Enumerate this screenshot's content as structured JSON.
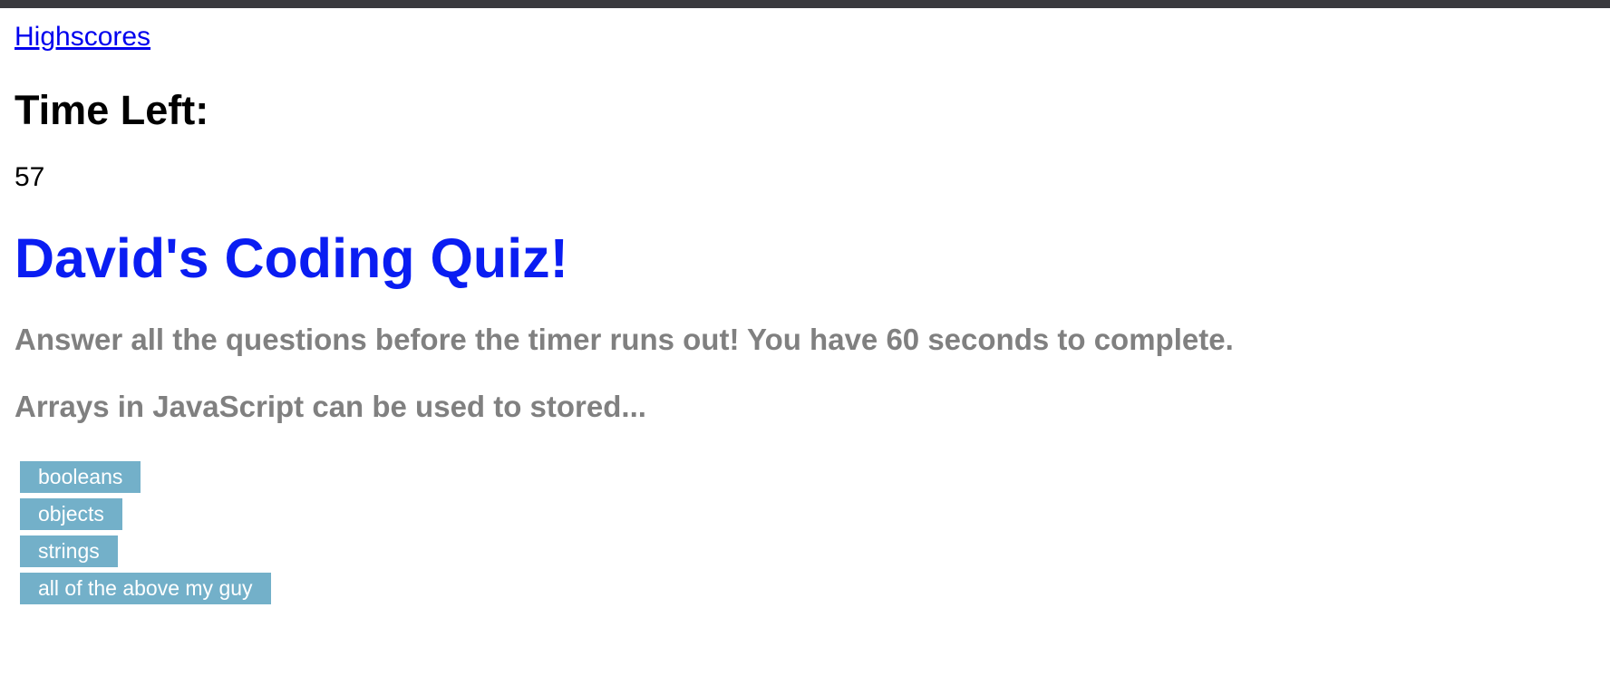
{
  "nav": {
    "highscores_label": "Highscores"
  },
  "timer": {
    "label": "Time Left:",
    "value": "57"
  },
  "quiz": {
    "title": "David's Coding Quiz!",
    "instructions": "Answer all the questions before the timer runs out! You have 60 seconds to complete.",
    "question": "Arrays in JavaScript can be used to stored...",
    "answers": [
      "booleans",
      "objects",
      "strings",
      "all of the above my guy"
    ]
  },
  "colors": {
    "title": "#0a1df2",
    "subtext": "#808080",
    "button_bg": "#73b0c9",
    "button_text": "#ffffff",
    "link": "#0000ee",
    "topbar": "#3a3a3e"
  }
}
